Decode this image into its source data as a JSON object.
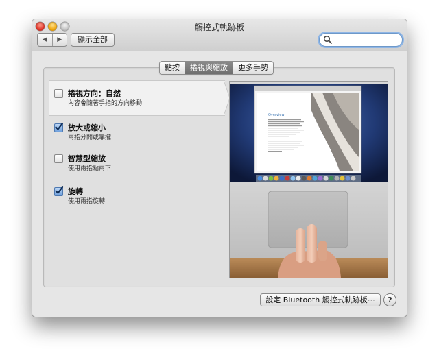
{
  "window": {
    "title": "觸控式軌跡板"
  },
  "toolbar": {
    "back": "◀",
    "forward": "▶",
    "show_all": "顯示全部",
    "search_value": ""
  },
  "tabs": [
    {
      "label": "點按",
      "active": false
    },
    {
      "label": "捲視與縮放",
      "active": true
    },
    {
      "label": "更多手勢",
      "active": false
    }
  ],
  "options": [
    {
      "title": "捲視方向：自然",
      "subtitle": "內容會隨著手指的方向移動",
      "checked": false
    },
    {
      "title": "放大或縮小",
      "subtitle": "兩指分開或靠攏",
      "checked": true
    },
    {
      "title": "智慧型縮放",
      "subtitle": "使用兩指點兩下",
      "checked": false
    },
    {
      "title": "旋轉",
      "subtitle": "使用兩指旋轉",
      "checked": true
    }
  ],
  "preview": {
    "doc_heading": "Overview"
  },
  "footer": {
    "bluetooth_button": "設定 Bluetooth 觸控式軌跡板⋯",
    "help": "?"
  },
  "colors": {
    "accent": "#5c8fd6",
    "close": "#e0382c",
    "minimize": "#f0a810",
    "zoom": "#c6c6c6",
    "desktop": "#2a4b8c"
  },
  "icons": {
    "search": "magnifier-icon",
    "help": "question-icon",
    "check": "checkmark-icon"
  }
}
